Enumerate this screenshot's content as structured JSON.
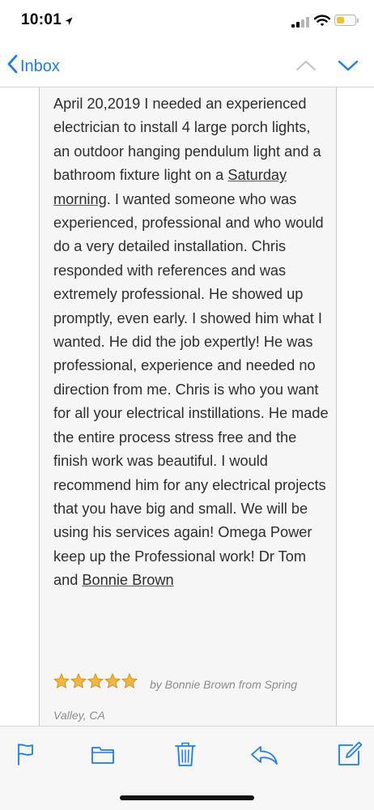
{
  "status_bar": {
    "time": "10:01",
    "battery_color": "#f3c32b"
  },
  "nav": {
    "back_label": "Inbox",
    "accent_color": "#1a7cf5",
    "icons": [
      "chevron-left-icon",
      "chevron-up-icon",
      "chevron-down-icon"
    ]
  },
  "review": {
    "text_1": "April 20,2019 I needed an experienced electrician to install 4 large porch lights, an outdoor hanging pendulum light and a bathroom fixture light on a ",
    "link_1": "Saturday morning",
    "text_2": ". I wanted someone who was experienced, professional and who would do a very detailed installation. Chris responded with references and was extremely professional. He showed up promptly, even early. I showed him what I wanted. He did the job expertly! He was professional, experience and needed no direction from me. Chris is who you want for all your electrical instillations. He made the entire process stress free and the finish work was beautiful. I would recommend him for any electrical projects that you have big and small. We will be using his services again! Omega Power keep up the Professional work! Dr Tom and ",
    "link_2": "Bonnie Brown",
    "rating": 5,
    "rating_max": 5,
    "byline_1": "by Bonnie Brown from Spring",
    "byline_2": "Valley, CA"
  },
  "toolbar": {
    "icons": [
      "flag-icon",
      "folder-icon",
      "trash-icon",
      "reply-icon",
      "compose-icon"
    ]
  }
}
